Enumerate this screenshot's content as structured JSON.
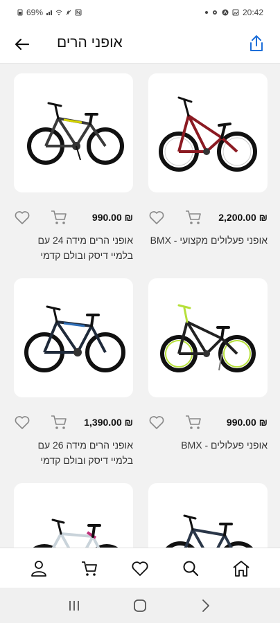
{
  "status_bar": {
    "battery": "69%",
    "time": "20:42"
  },
  "header": {
    "title": "אופני הרים"
  },
  "products": [
    {
      "name": "אופני פעלולים מקצועי - BMX",
      "price": "2,200.00 ₪",
      "frame_color": "#8b1a22",
      "image": "red-bmx-bike"
    },
    {
      "name": "אופני הרים מידה 24 עם בלמיי דיסק ובולם קדמי",
      "price": "990.00 ₪",
      "frame_color": "#3a3a3a",
      "image": "black-yellow-mountain-bike"
    },
    {
      "name": "אופני פעלולים - BMX",
      "price": "990.00 ₪",
      "frame_color": "#222222",
      "image": "black-lime-bmx-bike"
    },
    {
      "name": "אופני הרים מידה 26 עם בלמיי דיסק ובולם קדמי",
      "price": "1,390.00 ₪",
      "frame_color": "#1f2a3a",
      "image": "black-blue-mountain-bike"
    },
    {
      "name": "",
      "price": "",
      "frame_color": "#2a3648",
      "image": "dark-mountain-bike"
    },
    {
      "name": "",
      "price": "",
      "frame_color": "#e9eef2",
      "image": "white-mountain-bike"
    }
  ],
  "bottom_nav": [
    "home-icon",
    "search-icon",
    "heart-icon",
    "cart-icon",
    "profile-icon"
  ],
  "colors": {
    "accent": "#1e6fd9",
    "text": "#222222"
  }
}
